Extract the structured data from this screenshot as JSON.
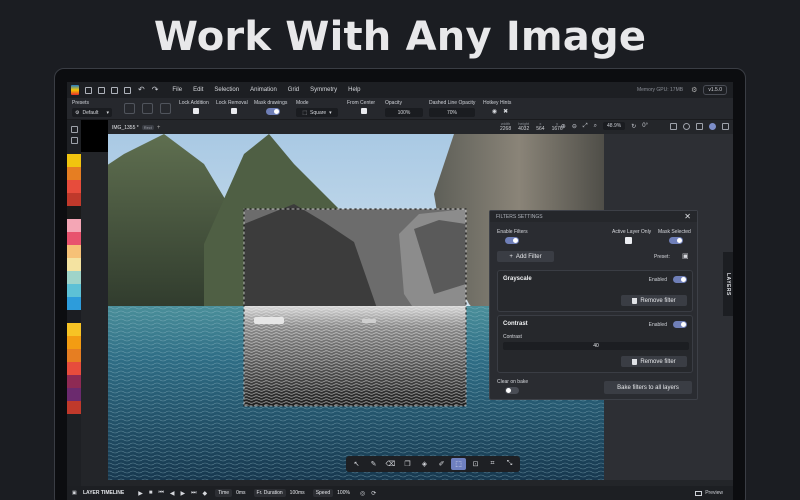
{
  "headline": "Work With Any Image",
  "menubar": {
    "menus": [
      "File",
      "Edit",
      "Selection",
      "Animation",
      "Grid",
      "Symmetry",
      "Help"
    ],
    "memory": "Memory GPU: 17MB",
    "version": "v1.5.0"
  },
  "toolbar": {
    "presets_label": "Presets",
    "presets_value": "Default",
    "lock_addition_label": "Lock Addition",
    "lock_removal_label": "Lock Removal",
    "mask_drawings_label": "Mask drawings",
    "mode_label": "Mode",
    "mode_value": "Square",
    "from_center_label": "From Center",
    "opacity_label": "Opacity",
    "opacity_value": "100%",
    "dashed_label": "Dashed Line Opacity",
    "dashed_value": "70%",
    "hotkey_label": "Hotkey Hints"
  },
  "tabbar": {
    "tab_name": "IMG_1355 *",
    "tab_badge": "Rect",
    "dims": [
      {
        "label": "width",
        "value": "2268"
      },
      {
        "label": "height",
        "value": "4032"
      },
      {
        "label": "x",
        "value": "564"
      },
      {
        "label": "y",
        "value": "1676"
      }
    ],
    "zoom": "48.9%",
    "rotation": "0°"
  },
  "swatches": [
    "#f1c40f",
    "#e67e22",
    "#e74c3c",
    "#c0392b",
    "#1a1a1a",
    "#f4a6b5",
    "#e8536e",
    "#f6c177",
    "#f4e3a1",
    "#9fd4c9",
    "#5dc1d6",
    "#2d9cdb",
    "#1b1d22",
    "#f7c325",
    "#f39c12",
    "#e67e22",
    "#e74c3c",
    "#8e2a54",
    "#6b2a6e",
    "#c0392b"
  ],
  "filters": {
    "title": "FILTERS SETTINGS",
    "enable_label": "Enable Filters",
    "active_layer_label": "Active Layer Only",
    "mask_selected_label": "Mask Selected",
    "add_filter": "Add Filter",
    "preset_label": "Preset:",
    "enabled_label": "Enabled",
    "grayscale_title": "Grayscale",
    "contrast_title": "Contrast",
    "contrast_param_label": "Contrast",
    "contrast_value": "40",
    "remove_filter": "Remove filter",
    "clear_on_bake": "Clear on bake",
    "bake_button": "Bake filters to all layers"
  },
  "layers_tab": "LAYERS",
  "timeline": {
    "label": "LAYER TIMELINE",
    "time_label": "Time",
    "time_value": "0ms",
    "duration_label": "Fr. Duration",
    "duration_value": "100ms",
    "speed_label": "Speed",
    "speed_value": "100%",
    "preview": "Preview"
  }
}
